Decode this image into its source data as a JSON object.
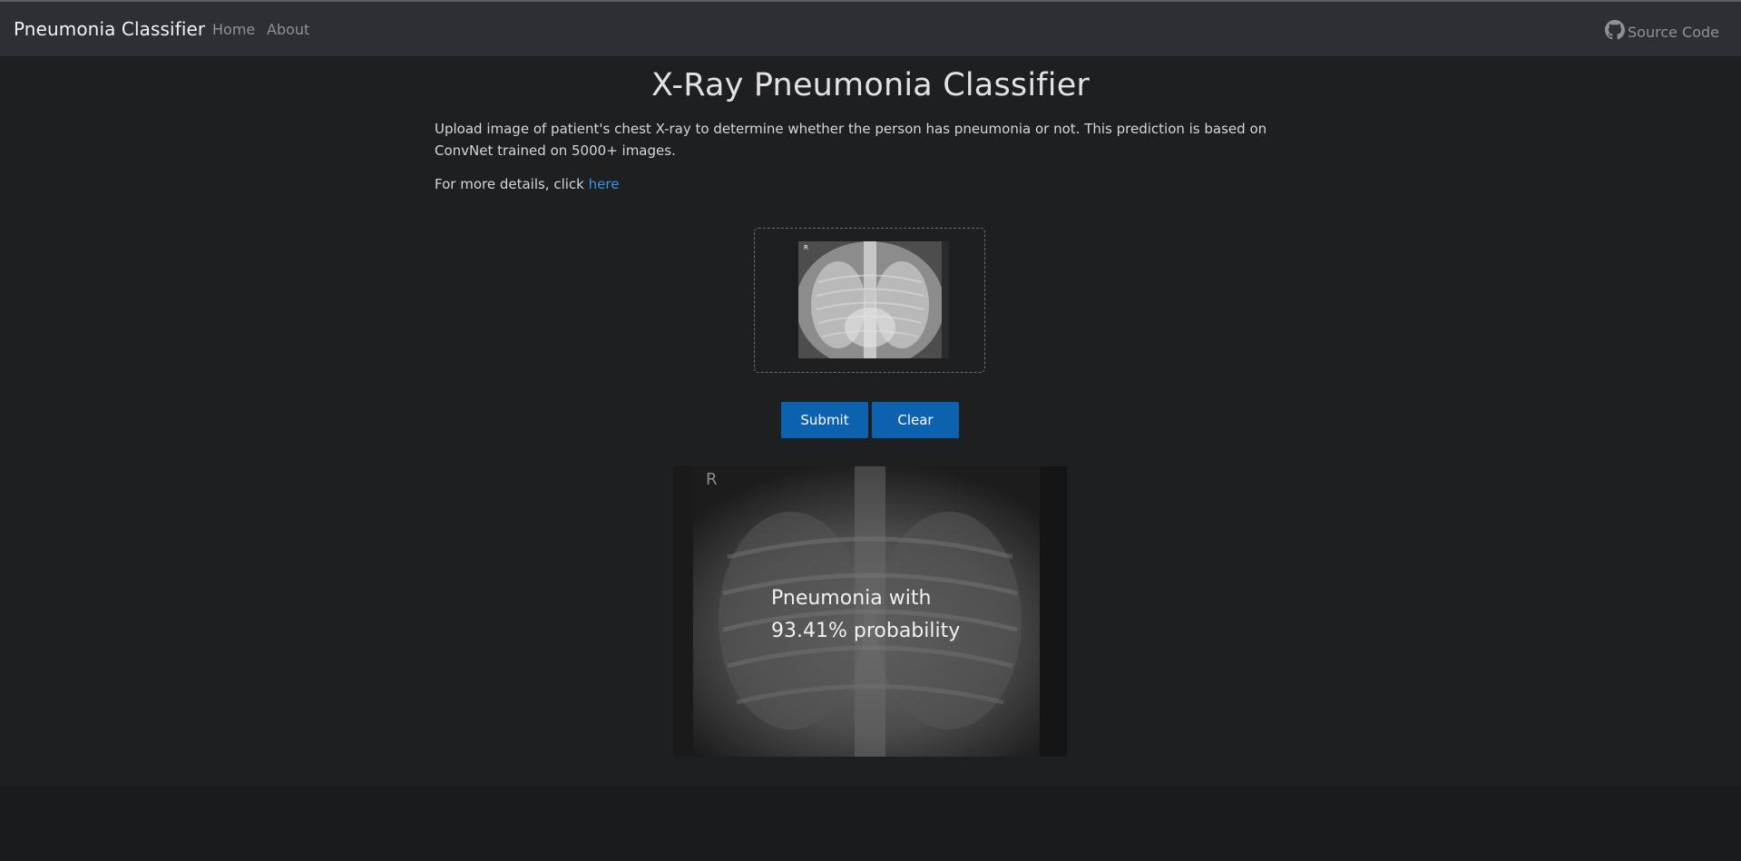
{
  "navbar": {
    "brand": "Pneumonia Classifier",
    "links": [
      {
        "label": "Home"
      },
      {
        "label": "About"
      }
    ],
    "source_label": "Source Code",
    "source_icon": "github-icon"
  },
  "main": {
    "title": "X-Ray Pneumonia Classifier",
    "description": "Upload image of patient's chest X-ray to determine whether the person has pneumonia or not. This prediction is based on ConvNet trained on 5000+ images.",
    "more_prefix": "For more details, click ",
    "more_link": "here"
  },
  "upload": {
    "preview_marker": "R"
  },
  "actions": {
    "submit_label": "Submit",
    "clear_label": "Clear"
  },
  "result": {
    "image_marker": "R",
    "line1": "Pneumonia with",
    "line2": "93.41% probability"
  },
  "colors": {
    "background": "#1e1f21",
    "navbar": "#2c2f33",
    "button": "#0d62b0",
    "link": "#3d8fe8"
  }
}
